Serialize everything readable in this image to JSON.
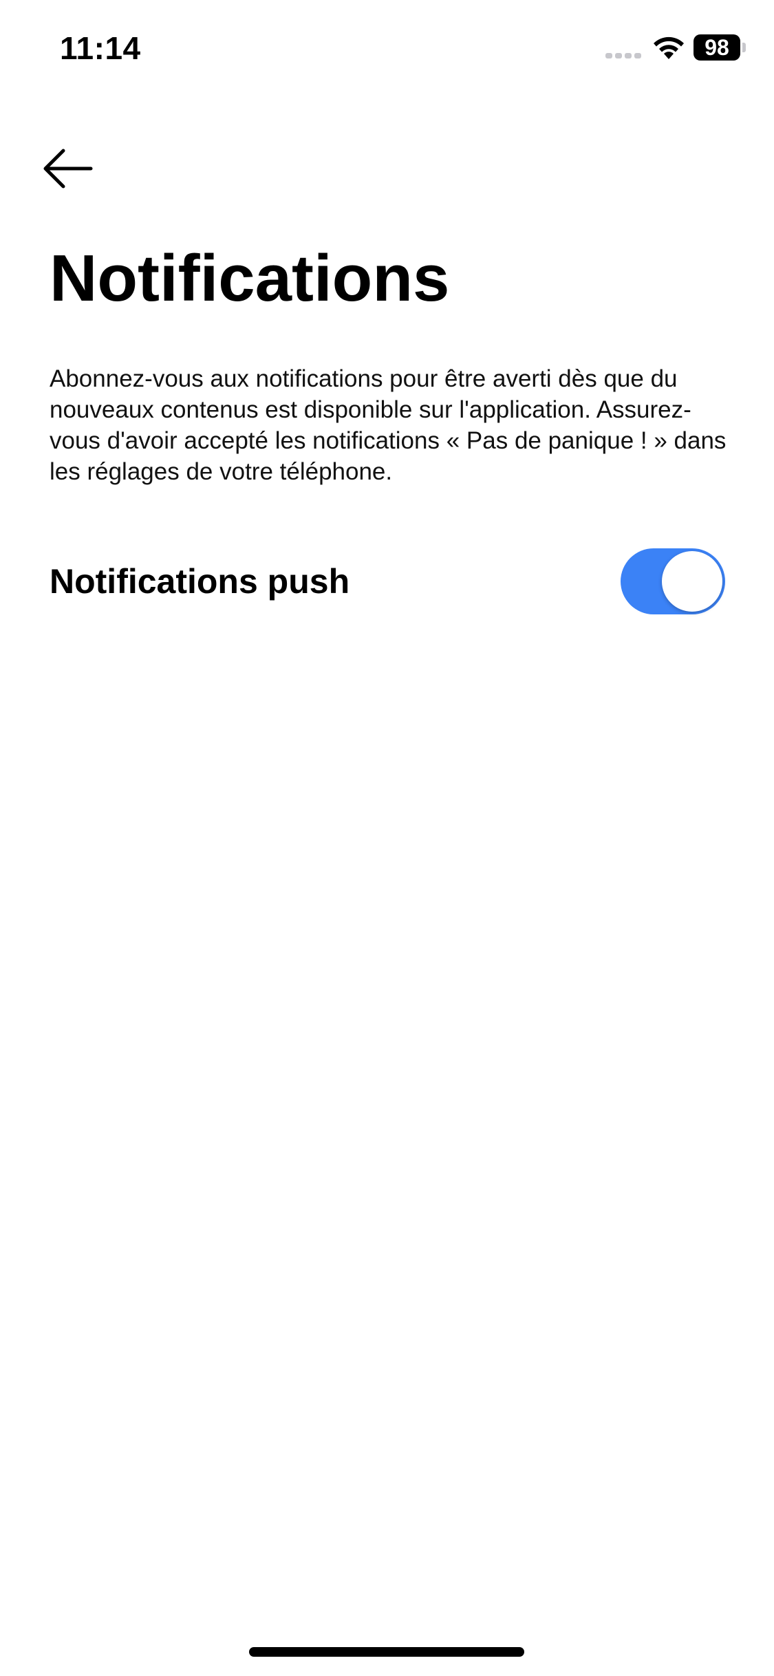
{
  "status_bar": {
    "time": "11:14",
    "battery_level": "98",
    "signal_icon": "cellular-signal-icon",
    "wifi_icon": "wifi-icon",
    "battery_icon": "battery-icon"
  },
  "nav": {
    "back_icon": "arrow-left-icon"
  },
  "page": {
    "title": "Notifications",
    "description": "Abonnez-vous aux notifications pour être averti dès que du nouveaux contenus est disponible sur l'application. Assurez-vous d'avoir accepté les notifications « Pas de panique ! » dans les réglages de votre téléphone."
  },
  "settings": {
    "push": {
      "label": "Notifications push",
      "enabled": true
    }
  },
  "colors": {
    "toggle_on": "#3b82f6",
    "text": "#000000",
    "background": "#ffffff"
  }
}
